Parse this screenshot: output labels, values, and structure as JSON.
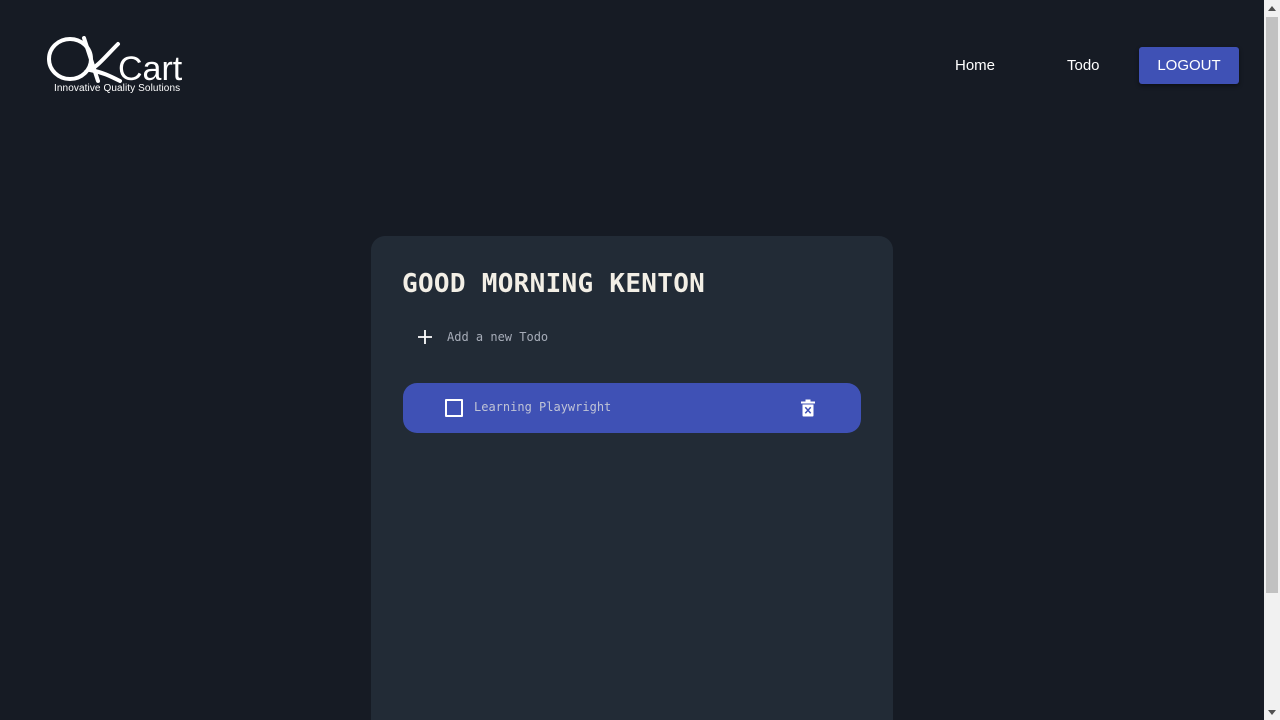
{
  "header": {
    "logo": {
      "text": "QkCart",
      "tagline": "Innovative Quality Solutions"
    },
    "nav": [
      {
        "label": "Home"
      },
      {
        "label": "Todo"
      }
    ],
    "logout_label": "LOGOUT"
  },
  "card": {
    "greeting": "GOOD MORNING KENTON",
    "add_todo_label": "Add a new Todo",
    "todos": [
      {
        "text": "Learning Playwright",
        "completed": false
      }
    ]
  },
  "icons": {
    "add": "plus-icon",
    "delete": "trash-icon",
    "checkbox": "checkbox-unchecked"
  },
  "colors": {
    "background": "#161b24",
    "card": "#222b36",
    "accent": "#3f51b5",
    "text": "#ffffff"
  }
}
